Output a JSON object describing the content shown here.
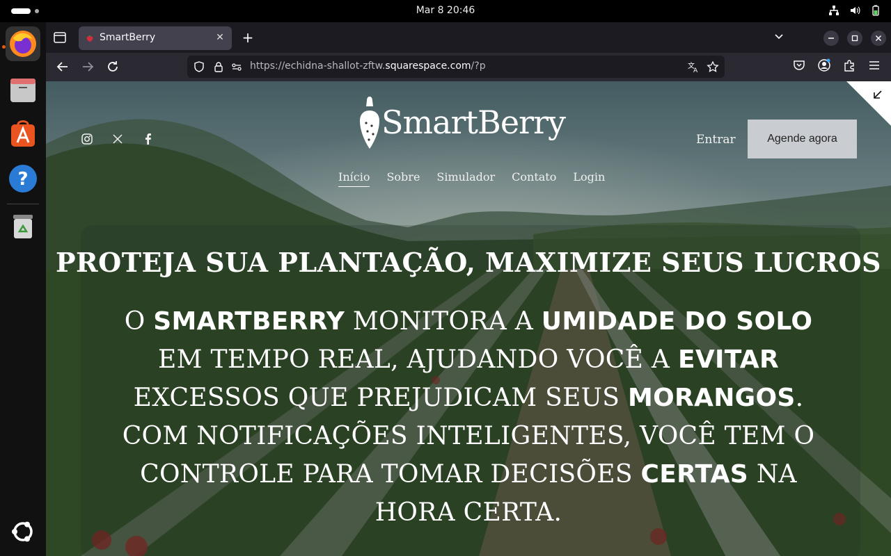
{
  "system": {
    "clock": "Mar 8  20:46"
  },
  "browser": {
    "tab_title": "SmartBerry",
    "url_prefix": "https://echidna-shallot-zftw.",
    "url_domain": "squarespace.com",
    "url_suffix": "/?p"
  },
  "site": {
    "logo_text": "SmartBerry",
    "login_link": "Entrar",
    "cta_button": "Agende agora",
    "nav": [
      {
        "label": "Início"
      },
      {
        "label": "Sobre"
      },
      {
        "label": "Simulador"
      },
      {
        "label": "Contato"
      },
      {
        "label": "Login"
      }
    ],
    "headline": "PROTEJA SUA PLANTAÇÃO, MAXIMIZE SEUS LUCROS",
    "body": {
      "p1": "O ",
      "b1": "SMARTBERRY",
      "p2": " MONITORA A ",
      "b2": "UMIDADE DO SOLO",
      "p3": " EM TEMPO REAL, AJUDANDO VOCÊ A ",
      "b3": "EVITAR",
      "p4": " EXCESSOS QUE PREJUDICAM SEUS ",
      "b4": "MORANGOS",
      "p5": ". COM NOTIFICAÇÕES INTELIGENTES, VOCÊ TEM O CONTROLE PARA TOMAR DECISÕES ",
      "b5": "CERTAS",
      "p6": " NA HORA CERTA."
    }
  },
  "colors": {
    "cta_bg": "#c9ccd0",
    "tab_bg": "#42414d",
    "urlbar_bg": "#1c1b22"
  }
}
